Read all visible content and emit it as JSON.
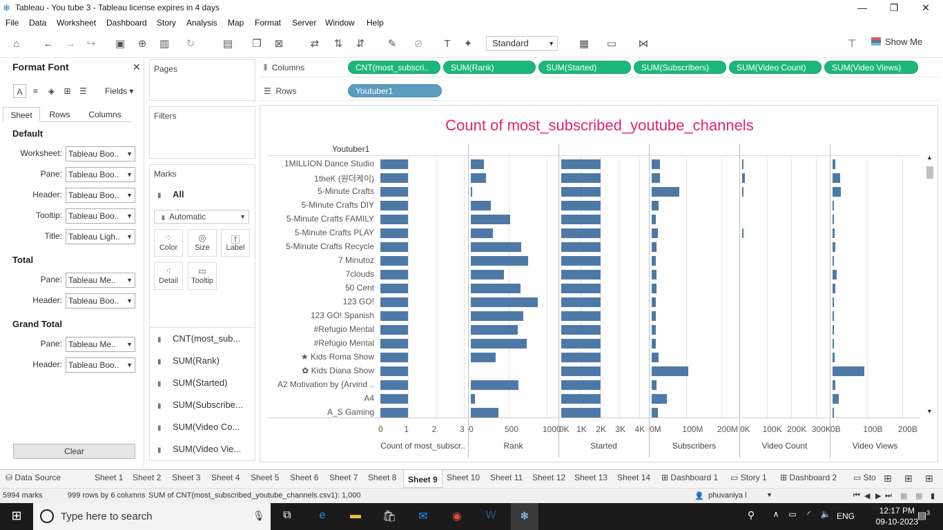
{
  "window": {
    "title": "Tableau - You tube 3 - Tableau license expires in 4 days",
    "min": "—",
    "max": "❐",
    "close": "✕"
  },
  "menu": [
    "File",
    "Data",
    "Worksheet",
    "Dashboard",
    "Story",
    "Analysis",
    "Map",
    "Format",
    "Server",
    "Window",
    "Help"
  ],
  "toolbar": {
    "fit": "Standard",
    "show_me": "Show Me"
  },
  "format_panel": {
    "title": "Format Font",
    "fields_label": "Fields",
    "tabs": [
      "Sheet",
      "Rows",
      "Columns"
    ],
    "sections": {
      "default": {
        "title": "Default",
        "rows": [
          {
            "label": "Worksheet:",
            "value": "Tableau Boo.."
          },
          {
            "label": "Pane:",
            "value": "Tableau Boo.."
          },
          {
            "label": "Header:",
            "value": "Tableau Boo.."
          },
          {
            "label": "Tooltip:",
            "value": "Tableau Boo.."
          },
          {
            "label": "Title:",
            "value": "Tableau Ligh.."
          }
        ]
      },
      "total": {
        "title": "Total",
        "rows": [
          {
            "label": "Pane:",
            "value": "Tableau Me.."
          },
          {
            "label": "Header:",
            "value": "Tableau Boo.."
          }
        ]
      },
      "grand_total": {
        "title": "Grand Total",
        "rows": [
          {
            "label": "Pane:",
            "value": "Tableau Me.."
          },
          {
            "label": "Header:",
            "value": "Tableau Boo.."
          }
        ]
      }
    },
    "clear": "Clear"
  },
  "pages": {
    "title": "Pages"
  },
  "filters": {
    "title": "Filters"
  },
  "marks": {
    "title": "Marks",
    "all": "All",
    "type": "Automatic",
    "cards": [
      "Color",
      "Size",
      "Label",
      "Detail",
      "Tooltip"
    ],
    "measures": [
      "CNT(most_sub...",
      "SUM(Rank)",
      "SUM(Started)",
      "SUM(Subscribe...",
      "SUM(Video Co...",
      "SUM(Video Vie..."
    ]
  },
  "shelves": {
    "columns_label": "Columns",
    "rows_label": "Rows",
    "columns": [
      "CNT(most_subscri..",
      "SUM(Rank)",
      "SUM(Started)",
      "SUM(Subscribers)",
      "SUM(Video Count)",
      "SUM(Video Views)"
    ],
    "rows": [
      "Youtuber1"
    ]
  },
  "viz": {
    "title": "Count of most_subscribed_youtube_channels",
    "row_header": "Youtuber1"
  },
  "chart_data": {
    "type": "bar",
    "title": "Count of most_subscribed_youtube_channels",
    "categories": [
      "1MILLION Dance Studio",
      "1theK (원더케이)",
      "5-Minute Crafts",
      "5-Minute Crafts DIY",
      "5-Minute Crafts FAMILY",
      "5-Minute Crafts PLAY",
      "5-Minute Crafts Recycle",
      "7 Minutoz",
      "7clouds",
      "50 Cent",
      "123 GO!",
      "123 GO! Spanish",
      "#Refugio Mental",
      "#Refúgio Mental",
      "★ Kids Roma Show",
      "✿ Kids Diana Show",
      "A2 Motivation by {Arvind ..",
      "A4",
      "A_S Gaming"
    ],
    "series": [
      {
        "name": "Count of most_subscr..",
        "axis": {
          "ticks": [
            "0",
            "1",
            "2",
            "3"
          ],
          "max": 3
        },
        "values": [
          1,
          1,
          1,
          1,
          1,
          1,
          1,
          1,
          1,
          1,
          1,
          1,
          1,
          1,
          1,
          1,
          1,
          1,
          1
        ]
      },
      {
        "name": "Rank",
        "axis": {
          "ticks": [
            "0",
            "500",
            "1000"
          ],
          "max": 1100
        },
        "values": [
          170,
          200,
          10,
          260,
          520,
          290,
          660,
          750,
          440,
          650,
          880,
          690,
          620,
          740,
          330,
          0,
          630,
          50,
          360
        ]
      },
      {
        "name": "Started",
        "axis": {
          "ticks": [
            "0K",
            "1K",
            "2K",
            "3K",
            "4K"
          ],
          "max": 4300
        },
        "values": [
          2010,
          2011,
          2016,
          2017,
          2017,
          2016,
          2016,
          2016,
          2016,
          2011,
          2016,
          2016,
          2014,
          2014,
          2017,
          2015,
          2015,
          2016,
          2015
        ]
      },
      {
        "name": "Subscribers",
        "axis": {
          "ticks": [
            "0M",
            "100M",
            "200M"
          ],
          "max": 240
        },
        "values": [
          24,
          24,
          80,
          20,
          12,
          18,
          14,
          12,
          14,
          14,
          12,
          12,
          12,
          12,
          19,
          106,
          13,
          43,
          18
        ]
      },
      {
        "name": "Video Count",
        "axis": {
          "ticks": [
            "0K",
            "100K",
            "200K",
            "300K"
          ],
          "max": 340
        },
        "values": [
          2,
          12,
          3,
          0,
          0,
          2,
          0,
          0,
          0,
          0,
          0,
          0,
          0,
          0,
          0,
          0,
          0,
          0,
          0
        ]
      },
      {
        "name": "Video Views",
        "axis": {
          "ticks": [
            "0B",
            "100B",
            "200B"
          ],
          "max": 240
        },
        "values": [
          8,
          22,
          24,
          4,
          4,
          6,
          8,
          2,
          12,
          8,
          4,
          4,
          4,
          4,
          6,
          92,
          8,
          18,
          4
        ]
      }
    ]
  },
  "sheet_tabs": [
    "Data Source",
    "Sheet 1",
    "Sheet 2",
    "Sheet 3",
    "Sheet 4",
    "Sheet 5",
    "Sheet 6",
    "Sheet 7",
    "Sheet 8",
    "Sheet 9",
    "Sheet 10",
    "Sheet 11",
    "Sheet 12",
    "Sheet 13",
    "Sheet 14",
    "Dashboard 1",
    "Story 1",
    "Dashboard 2",
    "Sto"
  ],
  "active_tab": "Sheet 9",
  "status": {
    "marks": "5994 marks",
    "rows": "999 rows by 6 columns",
    "sum": "SUM of CNT(most_subscribed_youtube_channels.csv1): 1,000",
    "user": "phuvaniya l"
  },
  "taskbar": {
    "search_placeholder": "Type here to search",
    "lang": "ENG",
    "time": "12:17 PM",
    "date": "09-10-2023",
    "notif": "3"
  }
}
